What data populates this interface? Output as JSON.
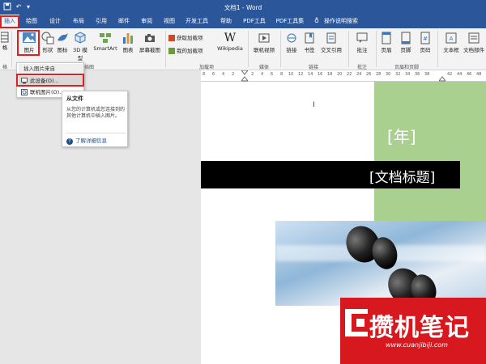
{
  "window": {
    "title": "文档1 - Word"
  },
  "tabs": [
    {
      "label": "插入",
      "active": true
    },
    {
      "label": "绘图"
    },
    {
      "label": "设计"
    },
    {
      "label": "布局"
    },
    {
      "label": "引用"
    },
    {
      "label": "邮件"
    },
    {
      "label": "审阅"
    },
    {
      "label": "视图"
    },
    {
      "label": "开发工具"
    },
    {
      "label": "帮助"
    },
    {
      "label": "PDF工具"
    },
    {
      "label": "PDF工具集"
    }
  ],
  "tell_me": "操作说明搜索",
  "ribbon": {
    "partial_left_labels": [
      "格",
      "格"
    ],
    "illustrations": {
      "pictures": "图片",
      "shapes": "形状",
      "icons": "图标",
      "models_3d": "3D 模型",
      "smartart": "SmartArt",
      "chart": "图表",
      "screenshot": "屏幕截图",
      "group_label": "插图"
    },
    "addins": {
      "get_addins": "获取加载项",
      "my_addins": "我的加载项",
      "wikipedia": "Wikipedia",
      "group_label": "加载项"
    },
    "media": {
      "online_video": "联机视频",
      "group_label": "媒体"
    },
    "links": {
      "link": "链接",
      "bookmark": "书签",
      "cross_ref": "交叉引用",
      "group_label": "链接"
    },
    "comments": {
      "comment": "批注",
      "group_label": "批注"
    },
    "header_footer": {
      "header": "页眉",
      "footer": "页脚",
      "page_number": "页码",
      "group_label": "页眉和页脚"
    },
    "text": {
      "textbox": "文本框",
      "quickparts": "文档部件"
    }
  },
  "picture_dropdown": {
    "header": "插入图片来自",
    "items": [
      "此设备(D)...",
      "联机图片(O)..."
    ]
  },
  "tooltip": {
    "title": "从文件",
    "body": "从您的计算机或您连接到的其他计算机中插入图片。",
    "link": "了解详细信息"
  },
  "ruler": {
    "numbers": [
      "8",
      "6",
      "4",
      "2",
      "",
      "2",
      "4",
      "6",
      "8",
      "10",
      "12",
      "14",
      "16",
      "18",
      "20",
      "22",
      "24",
      "26",
      "28",
      "30",
      "32",
      "34",
      "36",
      "38",
      "",
      "42",
      "44",
      "46",
      "48"
    ]
  },
  "document": {
    "year_placeholder": "[年]",
    "title_placeholder": "[文档标题]",
    "cursor": "I"
  },
  "watermark": {
    "text": "攒机笔记",
    "url": "www.cuanjibiji.com"
  },
  "colors": {
    "word_blue": "#2b579a",
    "highlight_red": "#e02020",
    "green_block": "#a9d08e",
    "watermark_red": "#d7191f"
  }
}
